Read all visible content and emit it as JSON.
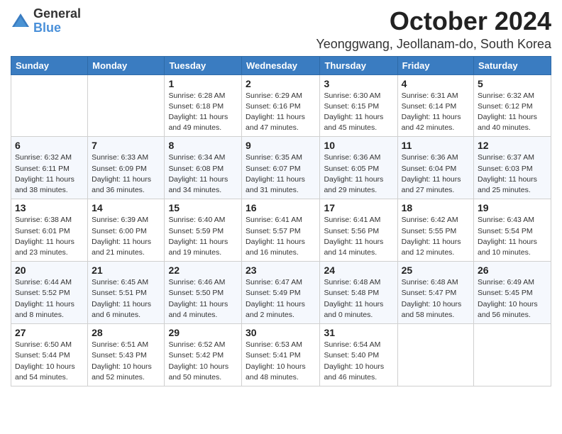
{
  "logo": {
    "general": "General",
    "blue": "Blue"
  },
  "header": {
    "month": "October 2024",
    "location": "Yeonggwang, Jeollanam-do, South Korea"
  },
  "weekdays": [
    "Sunday",
    "Monday",
    "Tuesday",
    "Wednesday",
    "Thursday",
    "Friday",
    "Saturday"
  ],
  "weeks": [
    [
      {
        "day": null
      },
      {
        "day": null
      },
      {
        "day": "1",
        "sunrise": "Sunrise: 6:28 AM",
        "sunset": "Sunset: 6:18 PM",
        "daylight": "Daylight: 11 hours and 49 minutes."
      },
      {
        "day": "2",
        "sunrise": "Sunrise: 6:29 AM",
        "sunset": "Sunset: 6:16 PM",
        "daylight": "Daylight: 11 hours and 47 minutes."
      },
      {
        "day": "3",
        "sunrise": "Sunrise: 6:30 AM",
        "sunset": "Sunset: 6:15 PM",
        "daylight": "Daylight: 11 hours and 45 minutes."
      },
      {
        "day": "4",
        "sunrise": "Sunrise: 6:31 AM",
        "sunset": "Sunset: 6:14 PM",
        "daylight": "Daylight: 11 hours and 42 minutes."
      },
      {
        "day": "5",
        "sunrise": "Sunrise: 6:32 AM",
        "sunset": "Sunset: 6:12 PM",
        "daylight": "Daylight: 11 hours and 40 minutes."
      }
    ],
    [
      {
        "day": "6",
        "sunrise": "Sunrise: 6:32 AM",
        "sunset": "Sunset: 6:11 PM",
        "daylight": "Daylight: 11 hours and 38 minutes."
      },
      {
        "day": "7",
        "sunrise": "Sunrise: 6:33 AM",
        "sunset": "Sunset: 6:09 PM",
        "daylight": "Daylight: 11 hours and 36 minutes."
      },
      {
        "day": "8",
        "sunrise": "Sunrise: 6:34 AM",
        "sunset": "Sunset: 6:08 PM",
        "daylight": "Daylight: 11 hours and 34 minutes."
      },
      {
        "day": "9",
        "sunrise": "Sunrise: 6:35 AM",
        "sunset": "Sunset: 6:07 PM",
        "daylight": "Daylight: 11 hours and 31 minutes."
      },
      {
        "day": "10",
        "sunrise": "Sunrise: 6:36 AM",
        "sunset": "Sunset: 6:05 PM",
        "daylight": "Daylight: 11 hours and 29 minutes."
      },
      {
        "day": "11",
        "sunrise": "Sunrise: 6:36 AM",
        "sunset": "Sunset: 6:04 PM",
        "daylight": "Daylight: 11 hours and 27 minutes."
      },
      {
        "day": "12",
        "sunrise": "Sunrise: 6:37 AM",
        "sunset": "Sunset: 6:03 PM",
        "daylight": "Daylight: 11 hours and 25 minutes."
      }
    ],
    [
      {
        "day": "13",
        "sunrise": "Sunrise: 6:38 AM",
        "sunset": "Sunset: 6:01 PM",
        "daylight": "Daylight: 11 hours and 23 minutes."
      },
      {
        "day": "14",
        "sunrise": "Sunrise: 6:39 AM",
        "sunset": "Sunset: 6:00 PM",
        "daylight": "Daylight: 11 hours and 21 minutes."
      },
      {
        "day": "15",
        "sunrise": "Sunrise: 6:40 AM",
        "sunset": "Sunset: 5:59 PM",
        "daylight": "Daylight: 11 hours and 19 minutes."
      },
      {
        "day": "16",
        "sunrise": "Sunrise: 6:41 AM",
        "sunset": "Sunset: 5:57 PM",
        "daylight": "Daylight: 11 hours and 16 minutes."
      },
      {
        "day": "17",
        "sunrise": "Sunrise: 6:41 AM",
        "sunset": "Sunset: 5:56 PM",
        "daylight": "Daylight: 11 hours and 14 minutes."
      },
      {
        "day": "18",
        "sunrise": "Sunrise: 6:42 AM",
        "sunset": "Sunset: 5:55 PM",
        "daylight": "Daylight: 11 hours and 12 minutes."
      },
      {
        "day": "19",
        "sunrise": "Sunrise: 6:43 AM",
        "sunset": "Sunset: 5:54 PM",
        "daylight": "Daylight: 11 hours and 10 minutes."
      }
    ],
    [
      {
        "day": "20",
        "sunrise": "Sunrise: 6:44 AM",
        "sunset": "Sunset: 5:52 PM",
        "daylight": "Daylight: 11 hours and 8 minutes."
      },
      {
        "day": "21",
        "sunrise": "Sunrise: 6:45 AM",
        "sunset": "Sunset: 5:51 PM",
        "daylight": "Daylight: 11 hours and 6 minutes."
      },
      {
        "day": "22",
        "sunrise": "Sunrise: 6:46 AM",
        "sunset": "Sunset: 5:50 PM",
        "daylight": "Daylight: 11 hours and 4 minutes."
      },
      {
        "day": "23",
        "sunrise": "Sunrise: 6:47 AM",
        "sunset": "Sunset: 5:49 PM",
        "daylight": "Daylight: 11 hours and 2 minutes."
      },
      {
        "day": "24",
        "sunrise": "Sunrise: 6:48 AM",
        "sunset": "Sunset: 5:48 PM",
        "daylight": "Daylight: 11 hours and 0 minutes."
      },
      {
        "day": "25",
        "sunrise": "Sunrise: 6:48 AM",
        "sunset": "Sunset: 5:47 PM",
        "daylight": "Daylight: 10 hours and 58 minutes."
      },
      {
        "day": "26",
        "sunrise": "Sunrise: 6:49 AM",
        "sunset": "Sunset: 5:45 PM",
        "daylight": "Daylight: 10 hours and 56 minutes."
      }
    ],
    [
      {
        "day": "27",
        "sunrise": "Sunrise: 6:50 AM",
        "sunset": "Sunset: 5:44 PM",
        "daylight": "Daylight: 10 hours and 54 minutes."
      },
      {
        "day": "28",
        "sunrise": "Sunrise: 6:51 AM",
        "sunset": "Sunset: 5:43 PM",
        "daylight": "Daylight: 10 hours and 52 minutes."
      },
      {
        "day": "29",
        "sunrise": "Sunrise: 6:52 AM",
        "sunset": "Sunset: 5:42 PM",
        "daylight": "Daylight: 10 hours and 50 minutes."
      },
      {
        "day": "30",
        "sunrise": "Sunrise: 6:53 AM",
        "sunset": "Sunset: 5:41 PM",
        "daylight": "Daylight: 10 hours and 48 minutes."
      },
      {
        "day": "31",
        "sunrise": "Sunrise: 6:54 AM",
        "sunset": "Sunset: 5:40 PM",
        "daylight": "Daylight: 10 hours and 46 minutes."
      },
      {
        "day": null
      },
      {
        "day": null
      }
    ]
  ]
}
